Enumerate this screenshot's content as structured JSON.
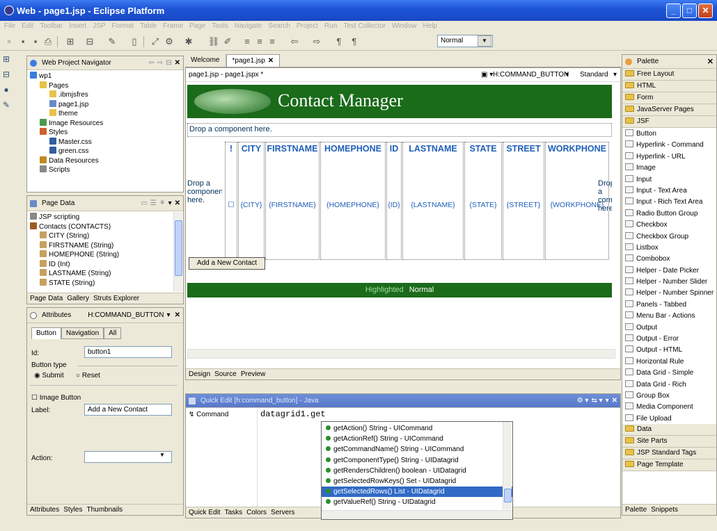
{
  "window": {
    "title": "Web - page1.jsp - Eclipse Platform",
    "minimize": "_",
    "maximize": "□",
    "close": "✕"
  },
  "menu": [
    "File",
    "Edit",
    "Toolbar",
    "Insert",
    "JSP",
    "Format",
    "Table",
    "Frame",
    "Page",
    "Tools",
    "Navigate",
    "Search",
    "Project",
    "Run",
    "Test Collector",
    "Window",
    "Help"
  ],
  "toolbar": {
    "style_value": "Normal"
  },
  "navigator": {
    "title": "Web Project Navigator",
    "tree": [
      {
        "label": "wp1",
        "indent": 0,
        "icon": "project-icon",
        "color": "#3a7de0"
      },
      {
        "label": "Pages",
        "indent": 1,
        "icon": "folder-icon",
        "color": "#e8c24a"
      },
      {
        "label": ".ibmjsfres",
        "indent": 2,
        "icon": "folder-icon",
        "color": "#e8c24a"
      },
      {
        "label": "page1.jsp",
        "indent": 2,
        "icon": "jsp-file-icon",
        "color": "#6a8ac8"
      },
      {
        "label": "theme",
        "indent": 2,
        "icon": "folder-icon",
        "color": "#e8c24a"
      },
      {
        "label": "Image Resources",
        "indent": 1,
        "icon": "image-icon",
        "color": "#4a9a4a"
      },
      {
        "label": "Styles",
        "indent": 1,
        "icon": "styles-icon",
        "color": "#d06030"
      },
      {
        "label": "Master.css",
        "indent": 2,
        "icon": "css-file-icon",
        "color": "#3060a0"
      },
      {
        "label": "green.css",
        "indent": 2,
        "icon": "css-file-icon",
        "color": "#3060a0"
      },
      {
        "label": "Data Resources",
        "indent": 1,
        "icon": "data-icon",
        "color": "#c08a20"
      },
      {
        "label": "Scripts",
        "indent": 1,
        "icon": "scripts-icon",
        "color": "#888888"
      }
    ]
  },
  "page_data": {
    "title": "Page Data",
    "tree": [
      {
        "label": "JSP scripting",
        "indent": 0,
        "icon": "script-icon",
        "color": "#888888"
      },
      {
        "label": "Contacts (CONTACTS)",
        "indent": 0,
        "icon": "table-icon",
        "color": "#a05a20"
      },
      {
        "label": "CITY (String)",
        "indent": 1,
        "icon": "field-icon",
        "color": "#c8a060"
      },
      {
        "label": "FIRSTNAME (String)",
        "indent": 1,
        "icon": "field-icon",
        "color": "#c8a060"
      },
      {
        "label": "HOMEPHONE (String)",
        "indent": 1,
        "icon": "field-icon",
        "color": "#c8a060"
      },
      {
        "label": "ID (Int)",
        "indent": 1,
        "icon": "field-icon",
        "color": "#c8a060"
      },
      {
        "label": "LASTNAME (String)",
        "indent": 1,
        "icon": "field-icon",
        "color": "#c8a060"
      },
      {
        "label": "STATE (String)",
        "indent": 1,
        "icon": "field-icon",
        "color": "#c8a060"
      }
    ],
    "tabs": [
      "Page Data",
      "Gallery",
      "Struts Explorer"
    ]
  },
  "attributes": {
    "title": "Attributes",
    "component": "H:COMMAND_BUTTON",
    "tabs": [
      "Button",
      "Navigation",
      "All"
    ],
    "id_label": "Id:",
    "id_value": "button1",
    "button_type_label": "Button type",
    "submit_label": "Submit",
    "reset_label": "Reset",
    "image_button_label": "Image Button",
    "label_label": "Label:",
    "label_value": "Add a New Contact",
    "action_label": "Action:",
    "action_value": "",
    "bottom_tabs": [
      "Attributes",
      "Styles",
      "Thumbnails"
    ]
  },
  "editor": {
    "tabs": [
      "Welcome",
      "*page1.jsp"
    ],
    "path": "page1.jsp - page1.jspx *",
    "component": "H:COMMAND_BUTTON",
    "mode": "Standard",
    "header_title": "Contact Manager",
    "drop_text": "Drop a component here.",
    "left_drop": "Drop a component here.",
    "right_drop": "Drop a component here",
    "columns": [
      {
        "header": "!",
        "cell": ""
      },
      {
        "header": "CITY",
        "cell": "{CITY}"
      },
      {
        "header": "FIRSTNAME",
        "cell": "{FIRSTNAME}"
      },
      {
        "header": "HOMEPHONE",
        "cell": "{HOMEPHONE}"
      },
      {
        "header": "ID",
        "cell": "{ID}"
      },
      {
        "header": "LASTNAME",
        "cell": "{LASTNAME}"
      },
      {
        "header": "STATE",
        "cell": "{STATE}"
      },
      {
        "header": "STREET",
        "cell": "{STREET}"
      },
      {
        "header": "WORKPHONE",
        "cell": "{WORKPHONE}"
      }
    ],
    "add_button": "Add a New Contact",
    "highlighted": "Highlighted",
    "normal": "Normal",
    "bottom_tabs": [
      "Design",
      "Source",
      "Preview"
    ]
  },
  "quick_edit": {
    "title": "Quick Edit [h:command_button] - Java",
    "event": "Command",
    "code": "datagrid1.get",
    "bottom_tabs": [
      "Quick Edit",
      "Tasks",
      "Colors",
      "Servers"
    ]
  },
  "content_assist": {
    "items": [
      {
        "label": "getAction()  String - UICommand",
        "selected": false
      },
      {
        "label": "getActionRef()  String - UICommand",
        "selected": false
      },
      {
        "label": "getCommandName()  String - UICommand",
        "selected": false
      },
      {
        "label": "getComponentType()  String - UIDatagrid",
        "selected": false
      },
      {
        "label": "getRendersChildren()  boolean - UIDatagrid",
        "selected": false
      },
      {
        "label": "getSelectedRowKeys()  Set - UIDatagrid",
        "selected": false
      },
      {
        "label": "getSelectedRows()  List - UIDatagrid",
        "selected": true
      },
      {
        "label": "getValueRef()  String - UIDatagrid",
        "selected": false
      }
    ]
  },
  "palette": {
    "title": "Palette",
    "drawers_top": [
      "Free Layout",
      "HTML",
      "Form",
      "JavaServer Pages"
    ],
    "open_drawer": "JSF",
    "items": [
      {
        "label": "Button",
        "icon": "button-icon"
      },
      {
        "label": "Hyperlink - Command",
        "icon": "hyperlink-icon"
      },
      {
        "label": "Hyperlink - URL",
        "icon": "hyperlink-icon"
      },
      {
        "label": "Image",
        "icon": "image-icon"
      },
      {
        "label": "Input",
        "icon": "input-icon"
      },
      {
        "label": "Input - Text Area",
        "icon": "textarea-icon"
      },
      {
        "label": "Input - Rich Text Area",
        "icon": "textarea-icon"
      },
      {
        "label": "Radio Button Group",
        "icon": "radio-icon"
      },
      {
        "label": "Checkbox",
        "icon": "checkbox-icon"
      },
      {
        "label": "Checkbox Group",
        "icon": "checkbox-group-icon"
      },
      {
        "label": "Listbox",
        "icon": "listbox-icon"
      },
      {
        "label": "Combobox",
        "icon": "combobox-icon"
      },
      {
        "label": "Helper - Date Picker",
        "icon": "date-icon"
      },
      {
        "label": "Helper - Number Slider",
        "icon": "slider-icon"
      },
      {
        "label": "Helper - Number Spinner",
        "icon": "spinner-icon"
      },
      {
        "label": "Panels - Tabbed",
        "icon": "panel-icon"
      },
      {
        "label": "Menu Bar - Actions",
        "icon": "menu-icon"
      },
      {
        "label": "Output",
        "icon": "output-icon"
      },
      {
        "label": "Output - Error",
        "icon": "error-icon"
      },
      {
        "label": "Output - HTML",
        "icon": "html-icon"
      },
      {
        "label": "Horizontal Rule",
        "icon": "rule-icon"
      },
      {
        "label": "Data Grid - Simple",
        "icon": "grid-icon"
      },
      {
        "label": "Data Grid - Rich",
        "icon": "grid-icon"
      },
      {
        "label": "Group Box",
        "icon": "group-icon"
      },
      {
        "label": "Media Component",
        "icon": "media-icon"
      },
      {
        "label": "File Upload",
        "icon": "upload-icon"
      }
    ],
    "drawers_bottom": [
      "Data",
      "Site Parts",
      "JSP Standard Tags",
      "Page Template"
    ],
    "bottom_tabs": [
      "Palette",
      "Snippets"
    ]
  }
}
